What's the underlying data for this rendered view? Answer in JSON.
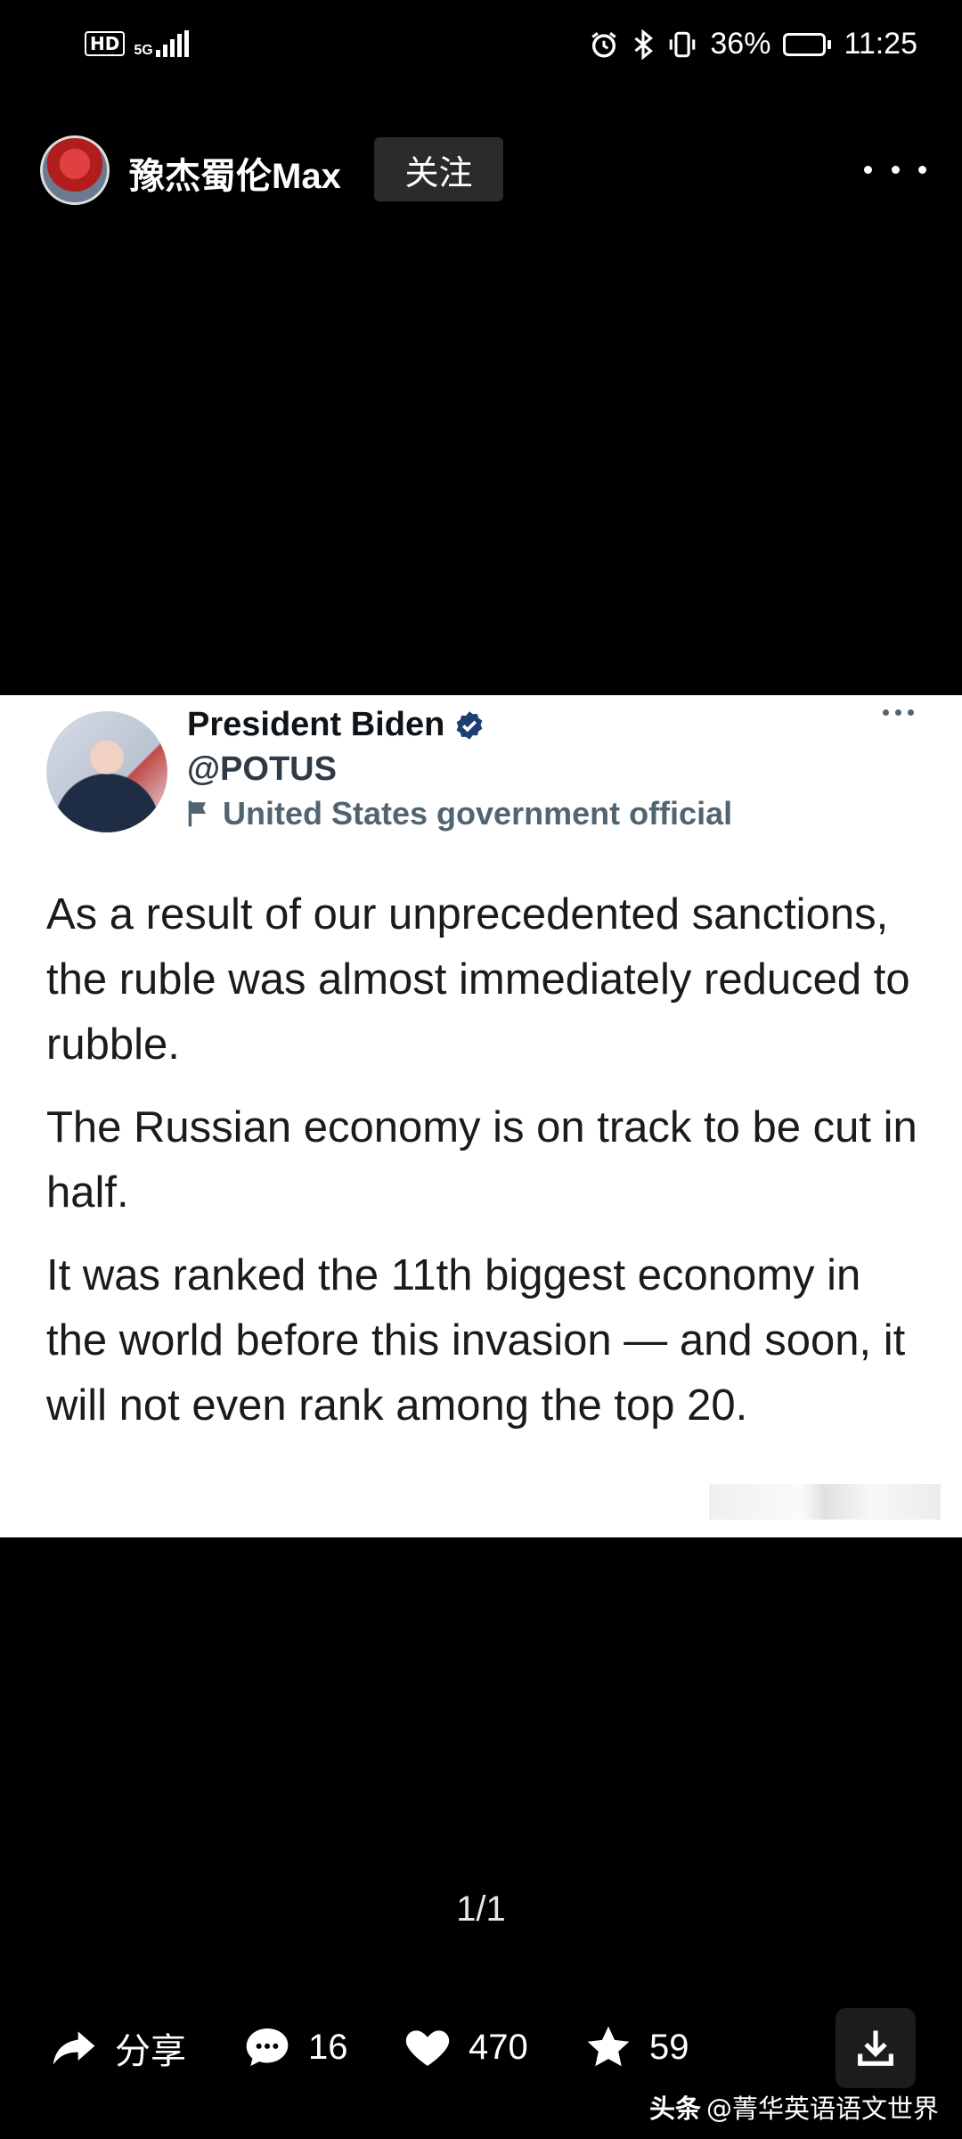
{
  "status_bar": {
    "hd": "HD",
    "network": "5G",
    "battery_percent": "36%",
    "battery_level": 0.36,
    "time": "11:25",
    "icons": [
      "alarm-icon",
      "bluetooth-icon",
      "vibrate-icon",
      "battery-icon"
    ]
  },
  "header": {
    "username": "豫杰蜀伦Max",
    "follow_label": "关注"
  },
  "tweet": {
    "name": "President Biden",
    "handle": "@POTUS",
    "official_label": "United States government official",
    "paragraphs": [
      "As a result of our unprecedented sanctions, the ruble was almost immediately reduced to rubble.",
      "The Russian economy is on track to be cut in half.",
      "It was ranked the 11th biggest economy in the world before this invasion — and soon, it will not even rank among the top 20."
    ]
  },
  "page_indicator": "1/1",
  "actions": {
    "share_label": "分享",
    "comments_count": "16",
    "likes_count": "470",
    "favorites_count": "59"
  },
  "footer": {
    "source": "头条",
    "author": "@菁华英语语文世界"
  },
  "colors": {
    "background": "#000000",
    "verified_blue": "#1d9bf0",
    "follow_button_bg": "#2b2b2b"
  }
}
